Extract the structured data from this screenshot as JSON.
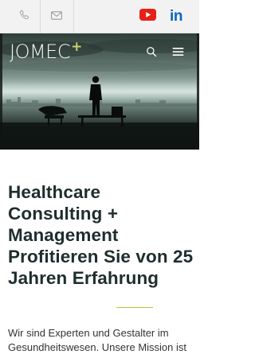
{
  "topbar": {
    "icons": [
      "phone-icon",
      "mail-icon",
      "youtube-icon",
      "linkedin-icon"
    ],
    "linkedin_text": "in"
  },
  "header": {
    "logo_text": "JOMEC",
    "logo_plus": "+",
    "icons": [
      "search-icon",
      "menu-icon"
    ]
  },
  "main": {
    "headline": "Healthcare Consulting + Management Profitieren Sie von 25 Jahren Erfahrung",
    "intro": "Wir sind Experten und Gestalter im Gesundheitswesen. Unsere Mission ist"
  },
  "colors": {
    "accent": "#c8d36a",
    "youtube": "#e62117",
    "linkedin": "#0a66c2",
    "heading": "#1f2d2d"
  }
}
